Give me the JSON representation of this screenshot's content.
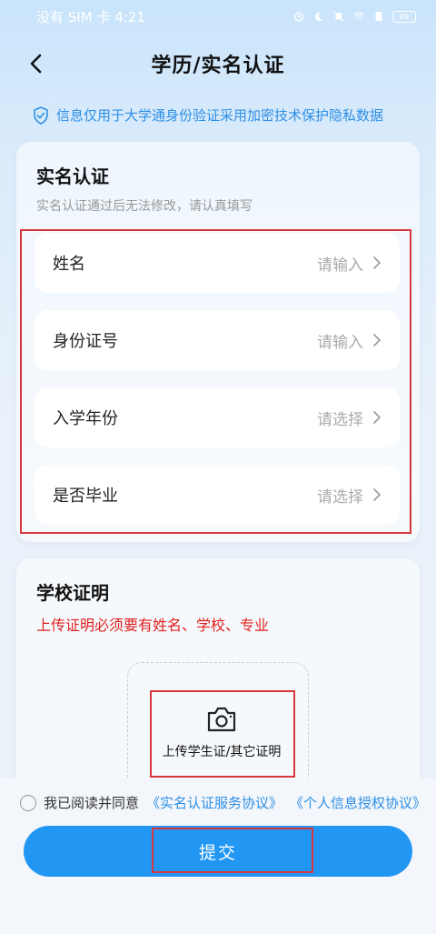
{
  "status": {
    "carrier_time": "没有 SIM 卡 4:21",
    "battery": "89"
  },
  "header": {
    "title": "学历/实名认证"
  },
  "privacy_note": "信息仅用于大学通身份验证采用加密技术保护隐私数据",
  "realname": {
    "title": "实名认证",
    "subtitle": "实名认证通过后无法修改，请认真填写",
    "fields": [
      {
        "label": "姓名",
        "placeholder": "请输入"
      },
      {
        "label": "身份证号",
        "placeholder": "请输入"
      },
      {
        "label": "入学年份",
        "placeholder": "请选择"
      },
      {
        "label": "是否毕业",
        "placeholder": "请选择"
      }
    ]
  },
  "school": {
    "title": "学校证明",
    "warning": "上传证明必须要有姓名、学校、专业",
    "upload_label": "上传学生证/其它证明"
  },
  "agreement": {
    "prefix": "我已阅读并同意",
    "link1": "《实名认证服务协议》",
    "link2": "《个人信息授权协议》"
  },
  "submit_label": "提交",
  "colors": {
    "accent": "#2196f3",
    "link": "#2e8fe6",
    "warning": "#e02020",
    "highlight": "#d9363e"
  }
}
